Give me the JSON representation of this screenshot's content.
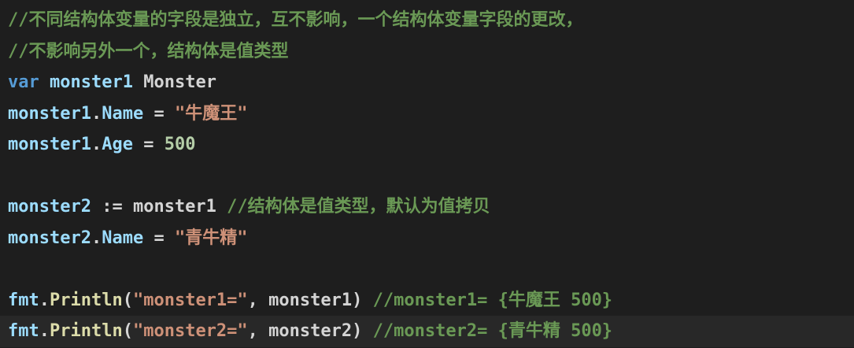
{
  "editor": {
    "lines": [
      {
        "comment": "//不同结构体变量的字段是独立，互不影响，一个结构体变量字段的更改，"
      },
      {
        "comment": "//不影响另外一个，结构体是值类型"
      },
      {
        "keyword": "var",
        "name": "monster1",
        "type": "Monster"
      },
      {
        "object": "monster1",
        "field": "Name",
        "op": " = ",
        "string": "\"牛魔王\""
      },
      {
        "object": "monster1",
        "field": "Age",
        "op": " = ",
        "number": "500"
      },
      {},
      {
        "name": "monster2",
        "op": " := ",
        "source": "monster1",
        "comment": "//结构体是值类型，默认为值拷贝"
      },
      {
        "object": "monster2",
        "field": "Name",
        "op": " = ",
        "string": "\"青牛精\""
      },
      {},
      {
        "pkg": "fmt",
        "func": "Println",
        "string": "\"monster1=\"",
        "arg": "monster1",
        "comment": "//monster1= {牛魔王 500}"
      },
      {
        "pkg": "fmt",
        "func": "Println",
        "string": "\"monster2=\"",
        "arg": "monster2",
        "comment": "//monster2= {青牛精 500}"
      }
    ]
  }
}
